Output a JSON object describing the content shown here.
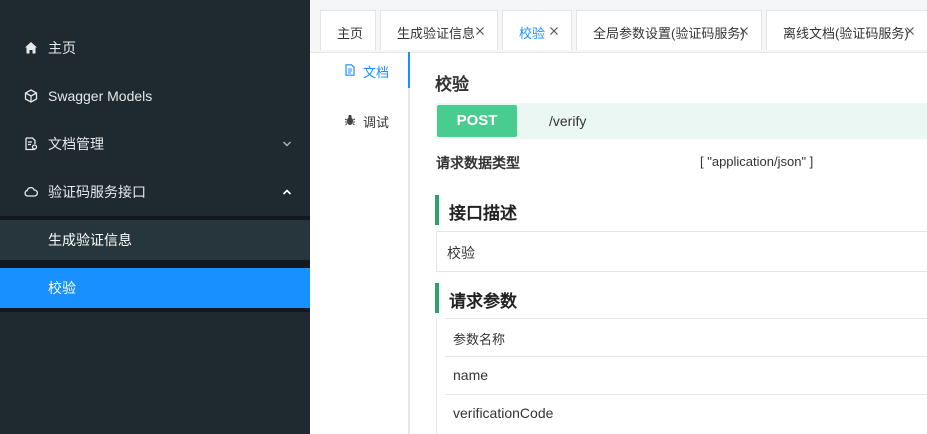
{
  "sidebar": {
    "items": [
      {
        "label": "主页",
        "icon": "home-icon"
      },
      {
        "label": "Swagger Models",
        "icon": "cube-icon"
      },
      {
        "label": "文档管理",
        "icon": "document-settings-icon"
      },
      {
        "label": "验证码服务接口",
        "icon": "cloud-icon"
      }
    ],
    "submenu": [
      {
        "label": "生成验证信息"
      },
      {
        "label": "校验"
      }
    ]
  },
  "tabs": [
    {
      "label": "主页"
    },
    {
      "label": "生成验证信息"
    },
    {
      "label": "校验"
    },
    {
      "label": "全局参数设置(验证码服务)"
    },
    {
      "label": "离线文档(验证码服务)"
    }
  ],
  "doc_tabs": [
    {
      "label": "文档",
      "icon": "document-icon"
    },
    {
      "label": "调试",
      "icon": "bug-icon"
    }
  ],
  "api": {
    "title": "校验",
    "method": "POST",
    "path": "/verify",
    "request_type_label": "请求数据类型",
    "request_type_value": "[ \"application/json\" ]",
    "desc_heading": "接口描述",
    "desc_text": "校验",
    "params_heading": "请求参数",
    "params": {
      "header": "参数名称",
      "rows": [
        "name",
        "verificationCode"
      ]
    }
  },
  "colors": {
    "sidebar_bg": "#1f2a30",
    "active_blue": "#1890ff",
    "post_green": "#49cc90",
    "section_accent": "#2e9f6d"
  }
}
